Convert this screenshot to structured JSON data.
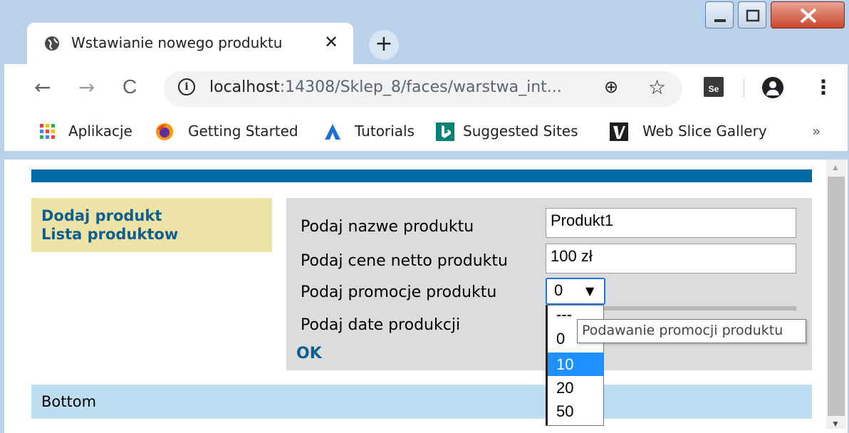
{
  "tab": {
    "title": "Wstawianie nowego produktu",
    "close": "✕",
    "new_tab": "+"
  },
  "toolbar": {
    "back": "←",
    "forward": "→",
    "reload": "C",
    "url_host": "localhost",
    "url_path": ":14308/Sklep_8/faces/warstwa_int...",
    "zoom": "⊕",
    "star": "☆",
    "extension_label": "Se",
    "menu": "⋮"
  },
  "bookmarks": [
    {
      "label": "Aplikacje",
      "icon": "apps-grid-icon"
    },
    {
      "label": "Getting Started",
      "icon": "firefox-icon"
    },
    {
      "label": "Tutorials",
      "icon": "atlassian-icon"
    },
    {
      "label": "Suggested Sites",
      "icon": "bing-icon"
    },
    {
      "label": "Web Slice Gallery",
      "icon": "web-slice-icon"
    }
  ],
  "bookmarks_more": "»",
  "sidebar": {
    "add_product": "Dodaj produkt",
    "product_list": "Lista produktow"
  },
  "form": {
    "name_label": "Podaj nazwe produktu",
    "name_value": "Produkt1",
    "price_label": "Podaj cene netto produktu",
    "price_value": "100 zł",
    "promo_label": "Podaj promocje produktu",
    "promo_value": "0",
    "date_label": "Podaj date produkcji",
    "ok_label": "OK"
  },
  "dropdown": {
    "options": [
      "---",
      "0",
      "10",
      "20",
      "50"
    ],
    "highlighted": "10"
  },
  "tooltip": "Podawanie promocji produktu",
  "footer": "Bottom",
  "colors": {
    "header_bar": "#006aa7",
    "sidebar_bg": "#ede3a6",
    "footer_bg": "#bdddf0",
    "link": "#0e5e8e",
    "highlight": "#1e90ff"
  }
}
